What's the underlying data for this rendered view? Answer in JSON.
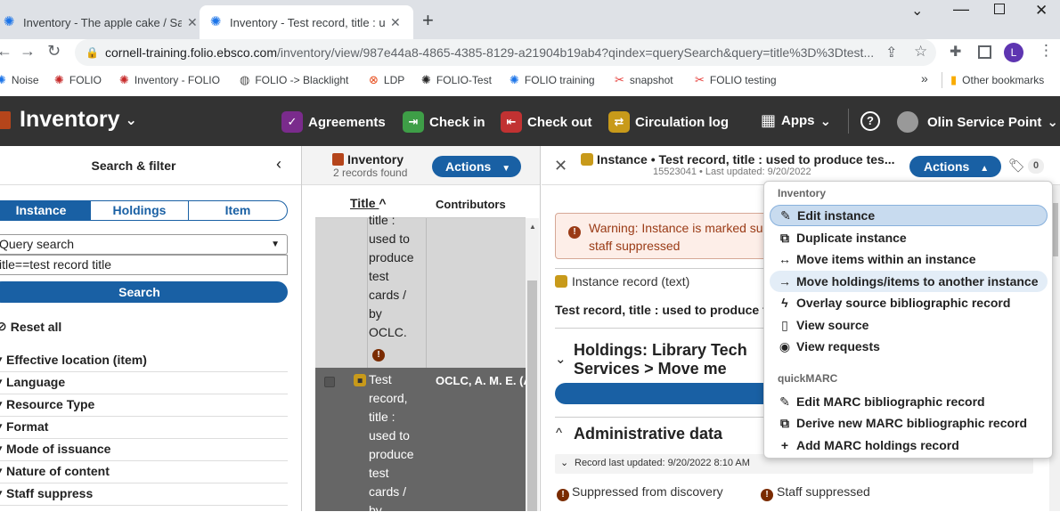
{
  "browser": {
    "tabs": [
      {
        "title": "Inventory - The apple cake / Sand",
        "active": false
      },
      {
        "title": "Inventory - Test record, title : used",
        "active": true
      }
    ],
    "url_host": "cornell-training.folio.ebsco.com",
    "url_path": "/inventory/view/987e44a8-4865-4385-8129-a21904b19ab4?qindex=querySearch&query=title%3D%3Dtest...",
    "profile_initial": "L",
    "bookmarks": [
      "Noise",
      "FOLIO",
      "Inventory - FOLIO",
      "FOLIO -> Blacklight",
      "LDP",
      "FOLIO-Test",
      "FOLIO training",
      "snapshot",
      "FOLIO testing"
    ],
    "other_bookmarks": "Other bookmarks",
    "more_bookmarks": "»"
  },
  "header": {
    "app_title": "Inventory",
    "nav": [
      "Agreements",
      "Check in",
      "Check out",
      "Circulation log"
    ],
    "apps_label": "Apps",
    "service_point": "Olin Service Point",
    "colors": {
      "bar": "#333333",
      "agreements": "#7a2b8c",
      "checkin": "#3e9e47",
      "checkout": "#c13232",
      "circlog": "#c89a1a"
    }
  },
  "filter": {
    "title": "Search & filter",
    "segments": [
      "Instance",
      "Holdings",
      "Item"
    ],
    "query_option": "Query search",
    "query_value": "itle==test record title",
    "search_label": "Search",
    "reset_label": "Reset all",
    "facets": [
      "Effective location (item)",
      "Language",
      "Resource Type",
      "Format",
      "Mode of issuance",
      "Nature of content",
      "Staff suppress"
    ]
  },
  "results": {
    "title": "Inventory",
    "count": "2 records found",
    "actions_label": "Actions",
    "columns": [
      "Title",
      "Contributors"
    ],
    "row1_lines": [
      "title :",
      "used to",
      "produce",
      "test",
      "cards /",
      "by",
      "OCLC."
    ],
    "row2_lines": [
      "Test",
      "record,",
      "title :",
      "used to",
      "produce",
      "test",
      "cards /",
      "by"
    ],
    "row2_contributor": "OCLC, A. M. E. (A"
  },
  "detail": {
    "title": "Instance • Test record, title : used to produce tes...",
    "subtitle": "15523041 • Last updated: 9/20/2022",
    "actions_label": "Actions",
    "tag_count": "0",
    "warning_line1": "Warning: Instance is marked su",
    "warning_line2": "staff suppressed",
    "instance_record_label": "Instance record (text)",
    "record_title": "Test record, title : used to produce t",
    "holdings_line1": "Holdings: Library Tech",
    "holdings_line2": "Services > Move me",
    "holdings_button_partial": "A",
    "admin_heading": "Administrative data",
    "record_last_updated": "Record last updated: 9/20/2022 8:10 AM",
    "suppressed_discovery": "Suppressed from discovery",
    "staff_suppressed": "Staff suppressed"
  },
  "menu": {
    "section1": "Inventory",
    "items1": [
      {
        "label": "Edit instance",
        "icon": "pencil-icon"
      },
      {
        "label": "Duplicate instance",
        "icon": "duplicate-icon"
      },
      {
        "label": "Move items within an instance",
        "icon": "arrows-icon"
      },
      {
        "label": "Move holdings/items to another instance",
        "icon": "arrow-right-icon"
      },
      {
        "label": "Overlay source bibliographic record",
        "icon": "lightning-icon"
      },
      {
        "label": "View source",
        "icon": "document-icon"
      },
      {
        "label": "View requests",
        "icon": "eye-icon"
      }
    ],
    "section2": "quickMARC",
    "items2": [
      {
        "label": "Edit MARC bibliographic record",
        "icon": "pencil-icon"
      },
      {
        "label": "Derive new MARC bibliographic record",
        "icon": "duplicate-icon"
      },
      {
        "label": "Add MARC holdings record",
        "icon": "plus-icon"
      }
    ]
  }
}
